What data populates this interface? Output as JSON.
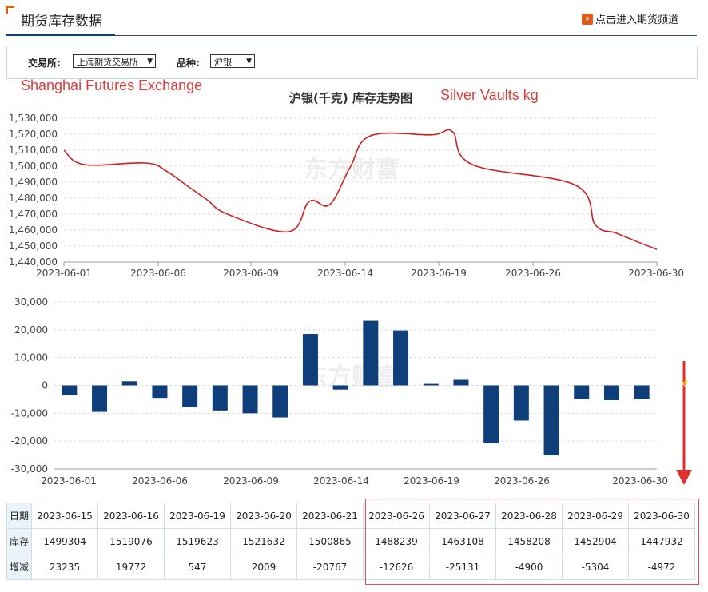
{
  "header": {
    "title": "期货库存数据",
    "link_label": "点击进入期货频道",
    "link_icon": "double-chevron-right-icon"
  },
  "filter": {
    "exchange_label": "交易所:",
    "exchange_value": "上海期货交易所",
    "variety_label": "品种:",
    "variety_value": "沪银"
  },
  "annotations": {
    "exchange_en": "Shanghai Futures Exchange",
    "vaults_en": "Silver Vaults kg"
  },
  "watermark": "东方财富",
  "colors": {
    "line": "#cc1f1f",
    "bar": "#0e3f7a",
    "annotation": "#e03a3a",
    "accent": "#e05a1c"
  },
  "chart_data": [
    {
      "type": "line",
      "title": "沪银(千克) 库存走势图",
      "x": [
        "2023-06-01",
        "2023-06-02",
        "2023-06-05",
        "2023-06-06",
        "2023-06-07",
        "2023-06-08",
        "2023-06-09",
        "2023-06-12",
        "2023-06-13",
        "2023-06-14",
        "2023-06-15",
        "2023-06-16",
        "2023-06-19",
        "2023-06-20",
        "2023-06-21",
        "2023-06-26",
        "2023-06-27",
        "2023-06-28",
        "2023-06-29",
        "2023-06-30"
      ],
      "values": [
        1510000,
        1501000,
        1502000,
        1497000,
        1488000,
        1479000,
        1470000,
        1459000,
        1478000,
        1476000,
        1499304,
        1519076,
        1519623,
        1521632,
        1500865,
        1488239,
        1463108,
        1458208,
        1452904,
        1447932
      ],
      "x_ticks": [
        "2023-06-01",
        "2023-06-06",
        "2023-06-09",
        "2023-06-14",
        "2023-06-19",
        "2023-06-26",
        "2023-06-30"
      ],
      "y_ticks": [
        "1,440,000",
        "1,450,000",
        "1,460,000",
        "1,470,000",
        "1,480,000",
        "1,490,000",
        "1,500,000",
        "1,510,000",
        "1,520,000",
        "1,530,000"
      ],
      "ylim": [
        1440000,
        1530000
      ],
      "grid": true
    },
    {
      "type": "bar",
      "categories": [
        "2023-06-01",
        "2023-06-02",
        "2023-06-05",
        "2023-06-06",
        "2023-06-07",
        "2023-06-08",
        "2023-06-09",
        "2023-06-12",
        "2023-06-13",
        "2023-06-14",
        "2023-06-15",
        "2023-06-16",
        "2023-06-19",
        "2023-06-20",
        "2023-06-21",
        "2023-06-26",
        "2023-06-27",
        "2023-06-28",
        "2023-06-29",
        "2023-06-30"
      ],
      "values": [
        -3500,
        -9500,
        1500,
        -4500,
        -7800,
        -9000,
        -10000,
        -11500,
        18500,
        -1500,
        23235,
        19772,
        547,
        2009,
        -20767,
        -12626,
        -25131,
        -4900,
        -5304,
        -4972
      ],
      "x_ticks": [
        "2023-06-01",
        "2023-06-06",
        "2023-06-09",
        "2023-06-14",
        "2023-06-19",
        "2023-06-26",
        "2023-06-30"
      ],
      "y_ticks": [
        "-30,000",
        "-20,000",
        "-10,000",
        "0",
        "10,000",
        "20,000",
        "30,000"
      ],
      "ylim": [
        -30000,
        30000
      ],
      "grid": true
    }
  ],
  "table": {
    "row_labels": [
      "日期",
      "库存",
      "增减"
    ],
    "dates": [
      "2023-06-15",
      "2023-06-16",
      "2023-06-19",
      "2023-06-20",
      "2023-06-21",
      "2023-06-26",
      "2023-06-27",
      "2023-06-28",
      "2023-06-29",
      "2023-06-30"
    ],
    "inventory": [
      "1499304",
      "1519076",
      "1519623",
      "1521632",
      "1500865",
      "1488239",
      "1463108",
      "1458208",
      "1452904",
      "1447932"
    ],
    "change": [
      "23235",
      "19772",
      "547",
      "2009",
      "-20767",
      "-12626",
      "-25131",
      "-4900",
      "-5304",
      "-4972"
    ]
  }
}
